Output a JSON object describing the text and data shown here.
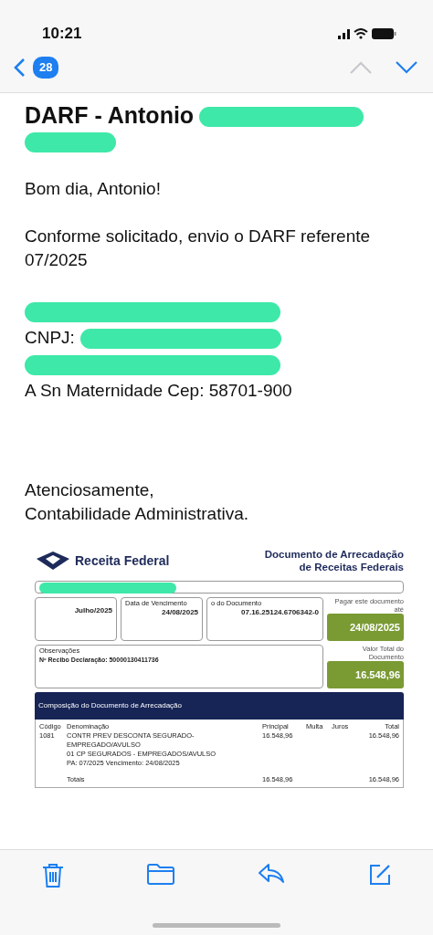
{
  "status_bar": {
    "time": "10:21"
  },
  "nav": {
    "unread_count": "28",
    "prev_enabled": false,
    "next_enabled": true
  },
  "email": {
    "subject": "DARF - Antonio",
    "subject_redacted": true,
    "paragraphs": [
      {
        "kind": "text",
        "text": "Bom dia, Antonio!"
      },
      {
        "kind": "text",
        "text": "Conforme solicitado, envio o DARF referente 07/2025"
      }
    ],
    "address_lines": [
      {
        "kind": "redacted"
      },
      {
        "kind": "partial",
        "text": "CNPJ:"
      },
      {
        "kind": "redacted"
      },
      {
        "kind": "text",
        "text": "A Sn Maternidade Cep: 58701-900"
      }
    ],
    "closing": [
      "Atenciosamente,",
      "Contabilidade Administrativa."
    ]
  },
  "document": {
    "logo_text": "Receita Federal",
    "title_lines": [
      "Documento de Arrecadação",
      "de Receitas Federais"
    ],
    "fields": [
      {
        "value": "Julho/2025"
      },
      {
        "label": "Data de Vencimento",
        "value": "24/08/2025"
      },
      {
        "label": "o do Documento",
        "value": "07.16.25124.6706342-0"
      }
    ],
    "pay_until": {
      "label": "Pagar este documento até",
      "value": "24/08/2025"
    },
    "observations": {
      "label": "Observações",
      "value": "Nº Recibo Declaração: 50000130411736"
    },
    "total": {
      "label": "Valor Total do Documento",
      "value": "16.548,96"
    },
    "composition": {
      "title": "Composição do Documento de Arrecadação",
      "columns": [
        "Código",
        "Denominação",
        "Principal",
        "Multa",
        "Juros",
        "Total"
      ],
      "rows": [
        {
          "code": "1081",
          "lines": [
            "CONTR PREV DESCONTA SEGURADO-EMPREGADO/AVULSO",
            "01 CP SEGURADOS - EMPREGADOS/AVULSO",
            "PA: 07/2025 Vencimento: 24/08/2025"
          ],
          "principal": "16.548,96",
          "total": "16.548,96"
        }
      ],
      "totals": {
        "label": "Totais",
        "principal": "16.548,96",
        "total": "16.548,96"
      }
    }
  }
}
